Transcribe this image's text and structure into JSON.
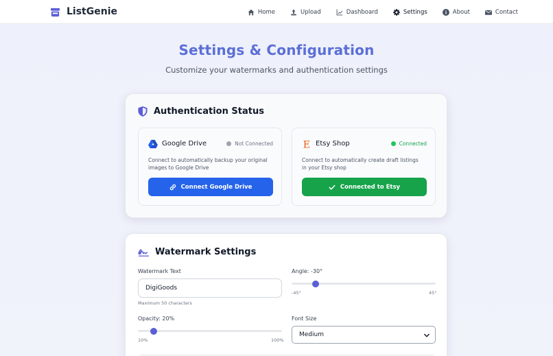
{
  "app": {
    "name": "ListGenie",
    "brand_color": "#5b6fd6"
  },
  "nav": {
    "items": [
      {
        "label": "Home",
        "icon": "home-icon"
      },
      {
        "label": "Upload",
        "icon": "upload-icon"
      },
      {
        "label": "Dashboard",
        "icon": "chart-line-icon"
      },
      {
        "label": "Settings",
        "icon": "gear-icon",
        "active": true
      },
      {
        "label": "About",
        "icon": "info-icon"
      },
      {
        "label": "Contact",
        "icon": "envelope-icon"
      }
    ]
  },
  "header": {
    "title": "Settings & Configuration",
    "subtitle": "Customize your watermarks and authentication settings"
  },
  "auth": {
    "title": "Authentication Status",
    "gdrive": {
      "name": "Google Drive",
      "status": "Not Connected",
      "description": "Connect to automatically backup your original images to Google Drive",
      "button": "Connect Google Drive"
    },
    "etsy": {
      "name": "Etsy Shop",
      "status": "Connected",
      "description": "Connect to automatically create draft listings in your Etsy shop",
      "button": "Connected to Etsy"
    }
  },
  "watermark": {
    "title": "Watermark Settings",
    "text_label": "Watermark Text",
    "text_value": "DigiGoods",
    "text_hint": "Maximum 50 characters",
    "angle_label": "Angle: -30°",
    "angle": {
      "min": -45,
      "max": 45,
      "value": -30,
      "min_label": "-45°",
      "max_label": "45°"
    },
    "opacity_label": "Opacity: 20%",
    "opacity": {
      "min": 10,
      "max": 100,
      "value": 20,
      "min_label": "10%",
      "max_label": "100%"
    },
    "font_size_label": "Font Size",
    "font_size_value": "Medium"
  },
  "colors": {
    "accent": "#5b5fd6",
    "primary_button": "#2563eb",
    "success": "#16a34a"
  }
}
